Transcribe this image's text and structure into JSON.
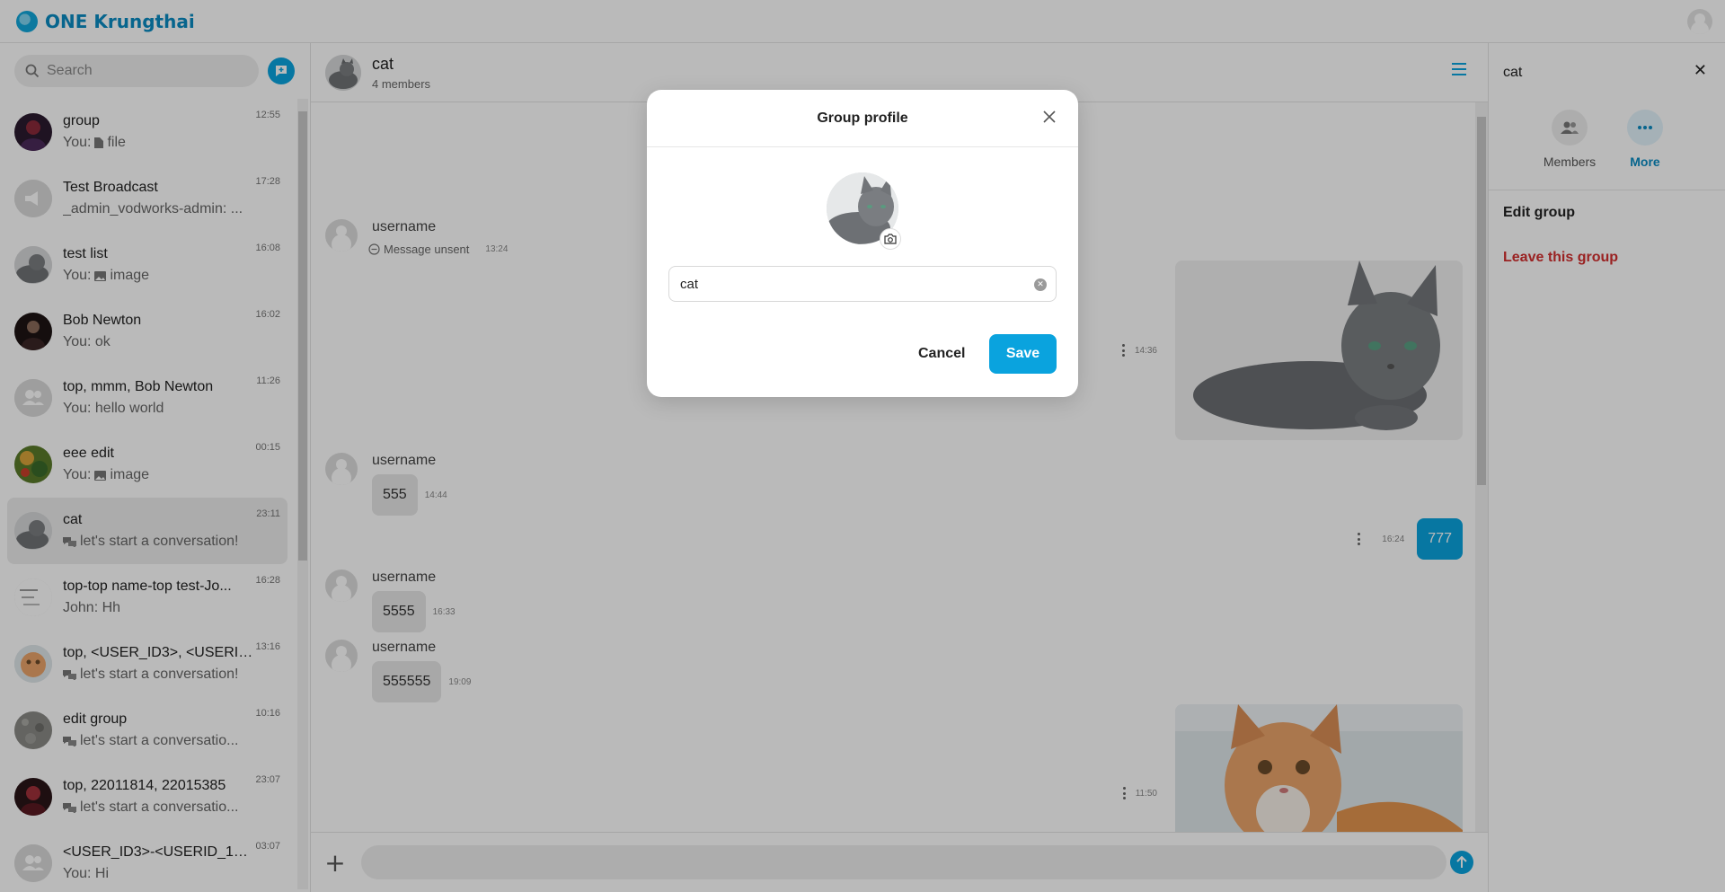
{
  "app": {
    "name": "ONE Krungthai"
  },
  "sidebar": {
    "search_placeholder": "Search",
    "chats": [
      {
        "name": "group",
        "preview": "You:",
        "preview_rest": "file",
        "preview_icon": "file-icon",
        "time": "12:55",
        "avatar": "dark-figure"
      },
      {
        "name": "Test Broadcast",
        "preview": "_admin_vodworks-admin: ...",
        "preview_rest": "",
        "preview_icon": "",
        "time": "17:28",
        "avatar": "broadcast-icon"
      },
      {
        "name": "test list",
        "preview": "You:",
        "preview_rest": "image",
        "preview_icon": "image-icon",
        "time": "16:08",
        "avatar": "cat-gray"
      },
      {
        "name": "Bob Newton",
        "preview": "You: ok",
        "preview_rest": "",
        "preview_icon": "",
        "time": "16:02",
        "avatar": "person-dark"
      },
      {
        "name": "top, mmm, Bob Newton",
        "preview": "You: hello world",
        "preview_rest": "",
        "preview_icon": "",
        "time": "11:26",
        "avatar": "group-icon"
      },
      {
        "name": "eee edit",
        "preview": "You:",
        "preview_rest": "image",
        "preview_icon": "image-icon",
        "time": "00:15",
        "avatar": "colorful"
      },
      {
        "name": "cat",
        "preview": "let's start a conversation!",
        "preview_rest": "",
        "preview_icon": "chat-bubbles-icon",
        "time": "23:11",
        "avatar": "cat-gray",
        "active": true
      },
      {
        "name": "top-top name-top test-Jo...",
        "preview": "John: Hh",
        "preview_rest": "",
        "preview_icon": "",
        "time": "16:28",
        "avatar": "lines"
      },
      {
        "name": "top, <USER_ID3>, <USERID_...",
        "preview": "let's start a conversation!",
        "preview_rest": "",
        "preview_icon": "chat-bubbles-icon",
        "time": "13:16",
        "avatar": "cat-orange"
      },
      {
        "name": "edit group",
        "preview": "let's start a conversatio...",
        "preview_rest": "",
        "preview_icon": "chat-bubbles-icon",
        "time": "10:16",
        "avatar": "texture"
      },
      {
        "name": "top, 22011814, 22015385",
        "preview": "let's start a conversatio...",
        "preview_rest": "",
        "preview_icon": "chat-bubbles-icon",
        "time": "23:07",
        "avatar": "dark-red"
      },
      {
        "name": "<USER_ID3>-<USERID_1>-<...",
        "preview": "You: Hi",
        "preview_rest": "",
        "preview_icon": "",
        "time": "03:07",
        "avatar": "group-icon"
      }
    ]
  },
  "chat": {
    "title": "cat",
    "subtitle": "4 members",
    "messages": {
      "m1_user": "username",
      "m1_unsent": "Message unsent",
      "m1_time": "13:24",
      "img1_time": "14:36",
      "m2_user": "username",
      "m2_text": "555",
      "m2_time": "14:44",
      "out_time": "16:24",
      "out_text": "777",
      "m3_user": "username",
      "m3_text": "5555",
      "m3_time": "16:33",
      "m4_user": "username",
      "m4_text": "555555",
      "m4_time": "19:09",
      "img2_time": "11:50"
    }
  },
  "right_panel": {
    "title": "cat",
    "members_label": "Members",
    "more_label": "More",
    "edit_group": "Edit group",
    "leave_group": "Leave this group"
  },
  "modal": {
    "title": "Group profile",
    "name_value": "cat",
    "cancel_label": "Cancel",
    "save_label": "Save"
  },
  "colors": {
    "accent": "#0aa3de",
    "brand": "#0a8bc2",
    "danger": "#d32f2f"
  }
}
